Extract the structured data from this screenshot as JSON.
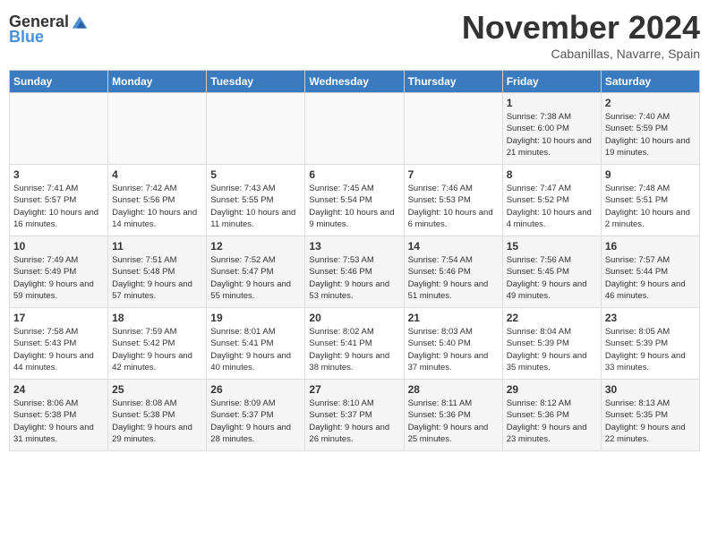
{
  "header": {
    "logo_line1": "General",
    "logo_line2": "Blue",
    "month": "November 2024",
    "location": "Cabanillas, Navarre, Spain"
  },
  "weekdays": [
    "Sunday",
    "Monday",
    "Tuesday",
    "Wednesday",
    "Thursday",
    "Friday",
    "Saturday"
  ],
  "weeks": [
    [
      {
        "day": "",
        "info": ""
      },
      {
        "day": "",
        "info": ""
      },
      {
        "day": "",
        "info": ""
      },
      {
        "day": "",
        "info": ""
      },
      {
        "day": "",
        "info": ""
      },
      {
        "day": "1",
        "info": "Sunrise: 7:38 AM\nSunset: 6:00 PM\nDaylight: 10 hours and 21 minutes."
      },
      {
        "day": "2",
        "info": "Sunrise: 7:40 AM\nSunset: 5:59 PM\nDaylight: 10 hours and 19 minutes."
      }
    ],
    [
      {
        "day": "3",
        "info": "Sunrise: 7:41 AM\nSunset: 5:57 PM\nDaylight: 10 hours and 16 minutes."
      },
      {
        "day": "4",
        "info": "Sunrise: 7:42 AM\nSunset: 5:56 PM\nDaylight: 10 hours and 14 minutes."
      },
      {
        "day": "5",
        "info": "Sunrise: 7:43 AM\nSunset: 5:55 PM\nDaylight: 10 hours and 11 minutes."
      },
      {
        "day": "6",
        "info": "Sunrise: 7:45 AM\nSunset: 5:54 PM\nDaylight: 10 hours and 9 minutes."
      },
      {
        "day": "7",
        "info": "Sunrise: 7:46 AM\nSunset: 5:53 PM\nDaylight: 10 hours and 6 minutes."
      },
      {
        "day": "8",
        "info": "Sunrise: 7:47 AM\nSunset: 5:52 PM\nDaylight: 10 hours and 4 minutes."
      },
      {
        "day": "9",
        "info": "Sunrise: 7:48 AM\nSunset: 5:51 PM\nDaylight: 10 hours and 2 minutes."
      }
    ],
    [
      {
        "day": "10",
        "info": "Sunrise: 7:49 AM\nSunset: 5:49 PM\nDaylight: 9 hours and 59 minutes."
      },
      {
        "day": "11",
        "info": "Sunrise: 7:51 AM\nSunset: 5:48 PM\nDaylight: 9 hours and 57 minutes."
      },
      {
        "day": "12",
        "info": "Sunrise: 7:52 AM\nSunset: 5:47 PM\nDaylight: 9 hours and 55 minutes."
      },
      {
        "day": "13",
        "info": "Sunrise: 7:53 AM\nSunset: 5:46 PM\nDaylight: 9 hours and 53 minutes."
      },
      {
        "day": "14",
        "info": "Sunrise: 7:54 AM\nSunset: 5:46 PM\nDaylight: 9 hours and 51 minutes."
      },
      {
        "day": "15",
        "info": "Sunrise: 7:56 AM\nSunset: 5:45 PM\nDaylight: 9 hours and 49 minutes."
      },
      {
        "day": "16",
        "info": "Sunrise: 7:57 AM\nSunset: 5:44 PM\nDaylight: 9 hours and 46 minutes."
      }
    ],
    [
      {
        "day": "17",
        "info": "Sunrise: 7:58 AM\nSunset: 5:43 PM\nDaylight: 9 hours and 44 minutes."
      },
      {
        "day": "18",
        "info": "Sunrise: 7:59 AM\nSunset: 5:42 PM\nDaylight: 9 hours and 42 minutes."
      },
      {
        "day": "19",
        "info": "Sunrise: 8:01 AM\nSunset: 5:41 PM\nDaylight: 9 hours and 40 minutes."
      },
      {
        "day": "20",
        "info": "Sunrise: 8:02 AM\nSunset: 5:41 PM\nDaylight: 9 hours and 38 minutes."
      },
      {
        "day": "21",
        "info": "Sunrise: 8:03 AM\nSunset: 5:40 PM\nDaylight: 9 hours and 37 minutes."
      },
      {
        "day": "22",
        "info": "Sunrise: 8:04 AM\nSunset: 5:39 PM\nDaylight: 9 hours and 35 minutes."
      },
      {
        "day": "23",
        "info": "Sunrise: 8:05 AM\nSunset: 5:39 PM\nDaylight: 9 hours and 33 minutes."
      }
    ],
    [
      {
        "day": "24",
        "info": "Sunrise: 8:06 AM\nSunset: 5:38 PM\nDaylight: 9 hours and 31 minutes."
      },
      {
        "day": "25",
        "info": "Sunrise: 8:08 AM\nSunset: 5:38 PM\nDaylight: 9 hours and 29 minutes."
      },
      {
        "day": "26",
        "info": "Sunrise: 8:09 AM\nSunset: 5:37 PM\nDaylight: 9 hours and 28 minutes."
      },
      {
        "day": "27",
        "info": "Sunrise: 8:10 AM\nSunset: 5:37 PM\nDaylight: 9 hours and 26 minutes."
      },
      {
        "day": "28",
        "info": "Sunrise: 8:11 AM\nSunset: 5:36 PM\nDaylight: 9 hours and 25 minutes."
      },
      {
        "day": "29",
        "info": "Sunrise: 8:12 AM\nSunset: 5:36 PM\nDaylight: 9 hours and 23 minutes."
      },
      {
        "day": "30",
        "info": "Sunrise: 8:13 AM\nSunset: 5:35 PM\nDaylight: 9 hours and 22 minutes."
      }
    ]
  ]
}
